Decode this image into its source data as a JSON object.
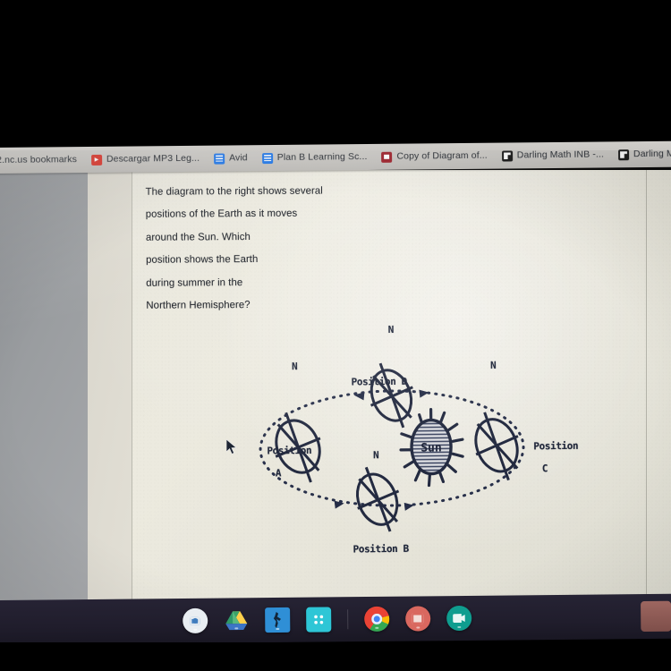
{
  "browser": {
    "bookmarks": [
      {
        "label": "2.nc.us bookmarks",
        "icon": "folder-icon"
      },
      {
        "label": "Descargar MP3 Leg...",
        "icon": "youtube-play-icon"
      },
      {
        "label": "Avid",
        "icon": "google-docs-icon"
      },
      {
        "label": "Plan B Learning Sc...",
        "icon": "google-docs-icon"
      },
      {
        "label": "Copy of Diagram of...",
        "icon": "google-slides-icon"
      },
      {
        "label": "Darling Math INB -...",
        "icon": "google-form-icon"
      },
      {
        "label": "Darling Math INB -...",
        "icon": "google-form-icon"
      }
    ]
  },
  "document": {
    "question_lines": [
      "The diagram to the right shows several",
      "positions of the Earth as it moves",
      "around the Sun.  Which",
      "position shows the Earth",
      "during summer in the",
      "Northern Hemisphere?"
    ]
  },
  "diagram": {
    "title": "earth-orbit-around-sun",
    "sun_label": "Sun",
    "positions": [
      {
        "id": "A",
        "label_line1": "Position",
        "label_line2": "A",
        "pole_label": "N"
      },
      {
        "id": "B",
        "label_line1": "Position B",
        "label_line2": "",
        "pole_label": "N"
      },
      {
        "id": "C",
        "label_line1": "Position",
        "label_line2": "C",
        "pole_label": "N"
      },
      {
        "id": "D",
        "label_line1": "Position D",
        "label_line2": "",
        "pole_label": "N"
      }
    ],
    "ink_color": "#232a40"
  },
  "shelf": {
    "apps": [
      {
        "name": "camera-app-icon",
        "label": "Camera"
      },
      {
        "name": "google-drive-icon",
        "label": "Drive"
      },
      {
        "name": "dance-app-icon",
        "label": "Just Dance"
      },
      {
        "name": "apps-grid-icon",
        "label": "Apps"
      },
      {
        "name": "chrome-icon",
        "label": "Chrome"
      },
      {
        "name": "photos-app-icon",
        "label": "Photos"
      },
      {
        "name": "video-app-icon",
        "label": "Camera Video"
      }
    ]
  }
}
